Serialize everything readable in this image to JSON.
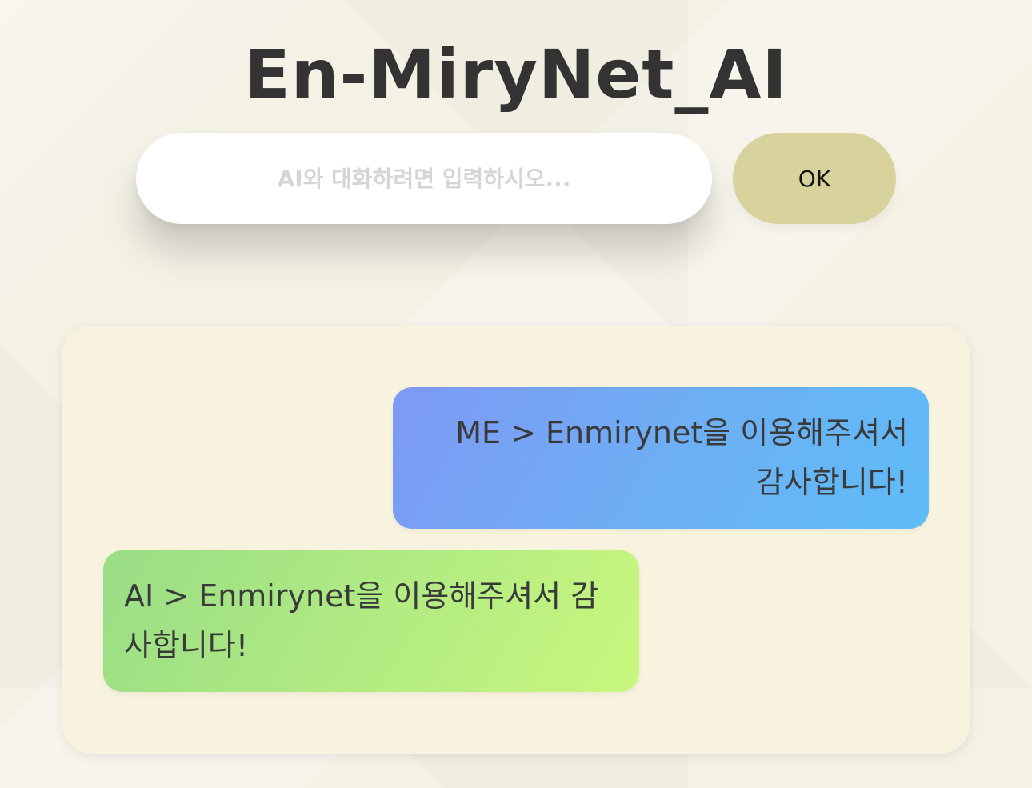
{
  "header": {
    "title": "En-MiryNet_AI"
  },
  "input": {
    "placeholder": "AI와 대화하려면 입력하시오...",
    "value": ""
  },
  "ok_button": {
    "label": "OK"
  },
  "messages": [
    {
      "sender": "ME",
      "text": "ME > Enmirynet을 이용해주셔서 감사합니다!",
      "color_start": "#7e99f4",
      "color_end": "#5fbcf8"
    },
    {
      "sender": "AI",
      "text": "AI > Enmirynet을 이용해주셔서 감사합니다!",
      "color_start": "#99dd86",
      "color_end": "#c9f77e"
    }
  ],
  "colors": {
    "background": "#f4f1e5",
    "panel": "#f8f3df",
    "ok_button": "#d8d39c",
    "title": "#333333"
  }
}
